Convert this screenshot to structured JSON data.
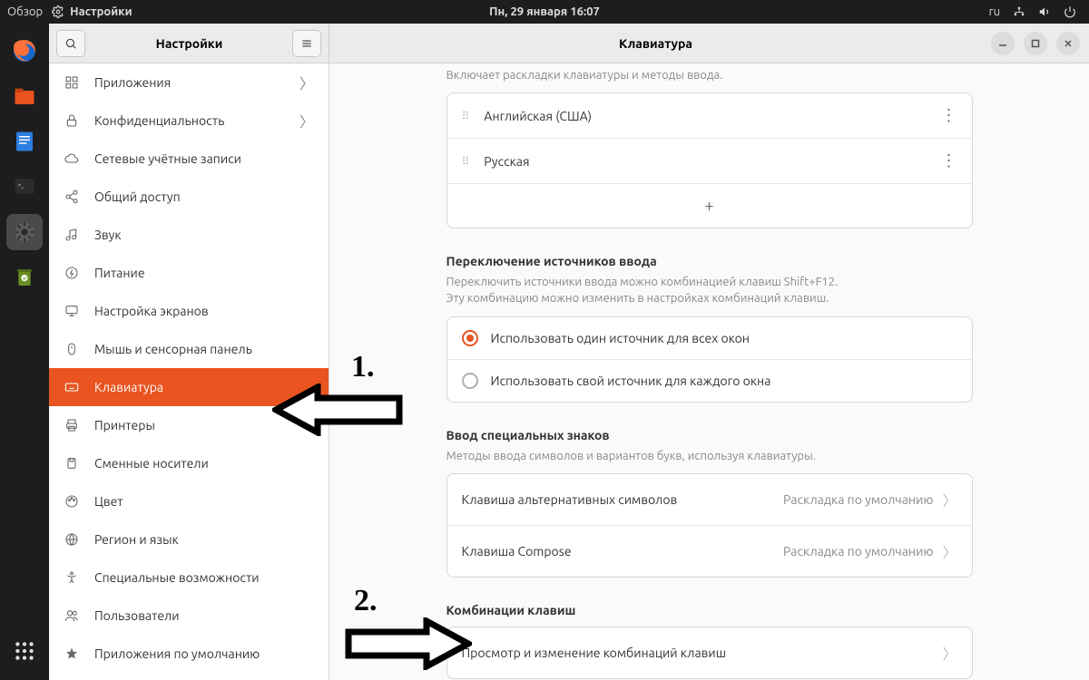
{
  "topbar": {
    "overview": "Обзор",
    "app_name": "Настройки",
    "datetime": "Пн, 29 января  16:07",
    "lang_indicator": "ru"
  },
  "header": {
    "sidebar_title": "Настройки",
    "content_title": "Клавиатура"
  },
  "sidebar": {
    "items": [
      {
        "icon": "apps",
        "label": "Приложения",
        "chev": true
      },
      {
        "icon": "lock",
        "label": "Конфиденциальность",
        "chev": true
      },
      {
        "icon": "cloud",
        "label": "Сетевые учётные записи"
      },
      {
        "icon": "share",
        "label": "Общий доступ"
      },
      {
        "icon": "sound",
        "label": "Звук"
      },
      {
        "icon": "power",
        "label": "Питание"
      },
      {
        "icon": "display",
        "label": "Настройка экранов"
      },
      {
        "icon": "mouse",
        "label": "Мышь и сенсорная панель"
      },
      {
        "icon": "keyboard",
        "label": "Клавиатура",
        "active": true
      },
      {
        "icon": "printer",
        "label": "Принтеры"
      },
      {
        "icon": "removable",
        "label": "Сменные носители"
      },
      {
        "icon": "color",
        "label": "Цвет"
      },
      {
        "icon": "region",
        "label": "Регион и язык"
      },
      {
        "icon": "a11y",
        "label": "Специальные возможности"
      },
      {
        "icon": "users",
        "label": "Пользователи"
      },
      {
        "icon": "defaults",
        "label": "Приложения по умолчанию"
      }
    ]
  },
  "content": {
    "intro_desc": "Включает раскладки клавиатуры и методы ввода.",
    "input_sources": [
      {
        "label": "Английская (США)"
      },
      {
        "label": "Русская"
      }
    ],
    "add_glyph": "+",
    "switch": {
      "title": "Переключение источников ввода",
      "desc1": "Переключить источники ввода можно комбинацией клавиш Shift+F12.",
      "desc2": "Эту комбинацию можно изменить в настройках комбинаций клавиш.",
      "opt_all": "Использовать один источник для всех окон",
      "opt_each": "Использовать свой источник для каждого окна"
    },
    "special": {
      "title": "Ввод специальных знаков",
      "desc": "Методы ввода символов и вариантов букв, используя клавиатуры.",
      "rows": [
        {
          "k": "Клавиша альтернативных символов",
          "v": "Раскладка по умолчанию"
        },
        {
          "k": "Клавиша Compose",
          "v": "Раскладка по умолчанию"
        }
      ]
    },
    "shortcuts": {
      "title": "Комбинации клавиш",
      "row": "Просмотр и изменение комбинаций клавиш"
    }
  },
  "annotations": {
    "one": "1.",
    "two": "2."
  }
}
